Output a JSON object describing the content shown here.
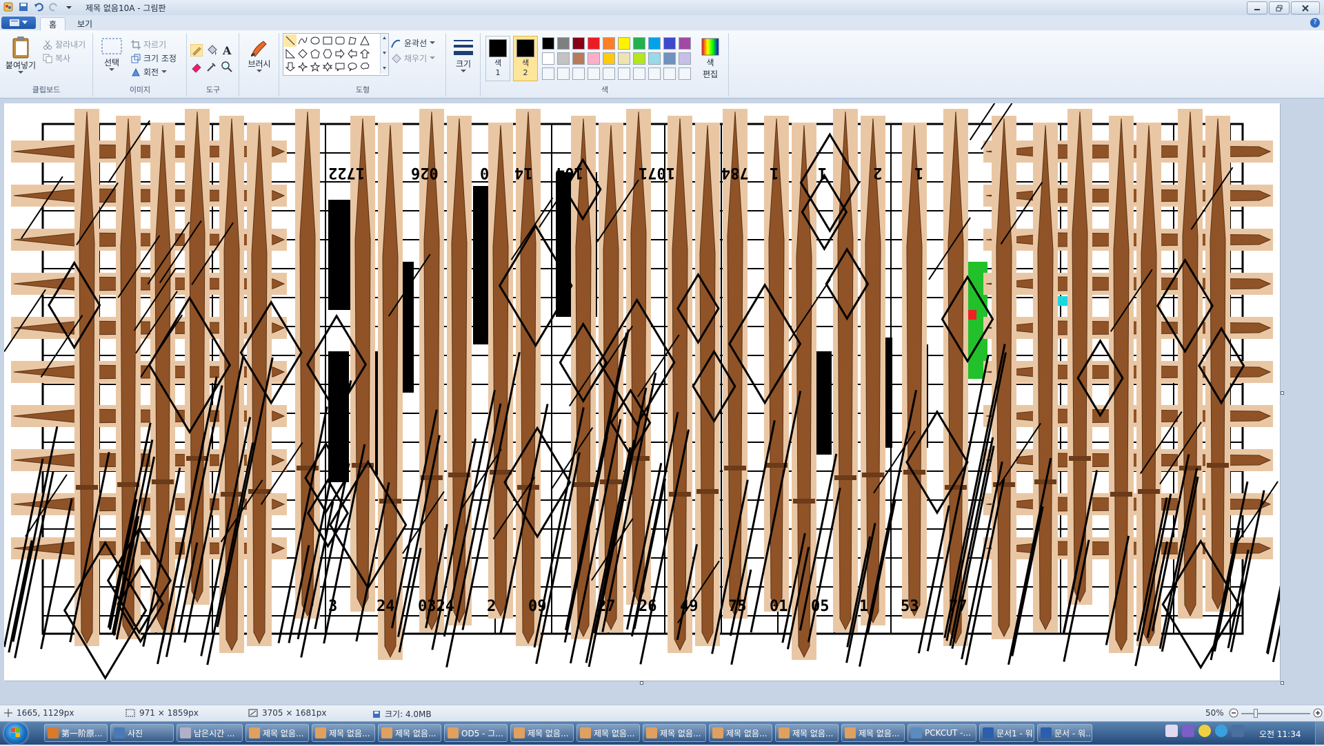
{
  "window": {
    "title": "제목 없음10A - 그림판"
  },
  "tabs": [
    {
      "label": "홈"
    },
    {
      "label": "보기"
    }
  ],
  "ribbon": {
    "clipboard": {
      "paste": "붙여넣기",
      "cut": "잘라내기",
      "copy": "복사",
      "label": "클립보드"
    },
    "image": {
      "select": "선택",
      "crop": "자르기",
      "resize": "크기 조정",
      "rotate": "회전",
      "label": "이미지"
    },
    "tools": {
      "label": "도구"
    },
    "brush": {
      "label": "브러시"
    },
    "shapes": {
      "outline": "윤곽선",
      "fill": "채우기",
      "label": "도형"
    },
    "size": {
      "label": "크기"
    },
    "colors": {
      "color1": "색\n1",
      "color1_text": "색",
      "color1_num": "1",
      "color2_text": "색",
      "color2_num": "2",
      "edit_text": "색",
      "edit_text2": "편집",
      "label": "색",
      "palette_row1": [
        "#000000",
        "#7f7f7f",
        "#880015",
        "#ed1c24",
        "#ff7f27",
        "#fff200",
        "#22b14c",
        "#00a2e8",
        "#3f48cc",
        "#a349a4"
      ],
      "palette_row2": [
        "#ffffff",
        "#c3c3c3",
        "#b97a57",
        "#ffaec9",
        "#ffc90e",
        "#efe4b0",
        "#b5e61d",
        "#99d9ea",
        "#7092be",
        "#c8bfe7"
      ],
      "color1_value": "#000000",
      "color2_value": "#000000"
    }
  },
  "status": {
    "cursor_pos": "1665, 1129px",
    "selection_size": "971 × 1859px",
    "image_size": "3705 × 1681px",
    "file_size": "크기: 4.0MB",
    "zoom": "50%"
  },
  "canvas_text": {
    "top_numbers": [
      "1722",
      "026",
      "0",
      "14",
      "104",
      "1071",
      "784",
      "1",
      "1",
      "2",
      "1"
    ],
    "bottom_numbers": [
      "3",
      "24",
      "0324",
      "2",
      "09",
      "27",
      "26",
      "49",
      "75",
      "01",
      "05",
      "1",
      "53",
      "77"
    ]
  },
  "taskbar": {
    "items": [
      {
        "label": "第一阶原...",
        "color": "#d97b2b"
      },
      {
        "label": "사진",
        "color": "#4a7ab5"
      },
      {
        "label": "남은시간 ...",
        "color": "#b0b0c8"
      },
      {
        "label": "제목 없음...",
        "color": "#e0a060"
      },
      {
        "label": "제목 없음...",
        "color": "#e0a060"
      },
      {
        "label": "제목 없음...",
        "color": "#e0a060"
      },
      {
        "label": "OD5 - 그...",
        "color": "#e0a060"
      },
      {
        "label": "제목 없음...",
        "color": "#e0a060"
      },
      {
        "label": "제목 없음...",
        "color": "#e0a060"
      },
      {
        "label": "제목 없음...",
        "color": "#e0a060"
      },
      {
        "label": "제목 없음...",
        "color": "#e0a060"
      },
      {
        "label": "제목 없음...",
        "color": "#e0a060"
      },
      {
        "label": "제목 없음...",
        "color": "#e0a060"
      },
      {
        "label": "PCKCUT -...",
        "color": "#5c8bc0"
      },
      {
        "label": "문서1 - 워...",
        "color": "#2b5fae"
      },
      {
        "label": "문서 - 워...",
        "color": "#2b5fae"
      }
    ],
    "clock": "오전 11:34"
  }
}
